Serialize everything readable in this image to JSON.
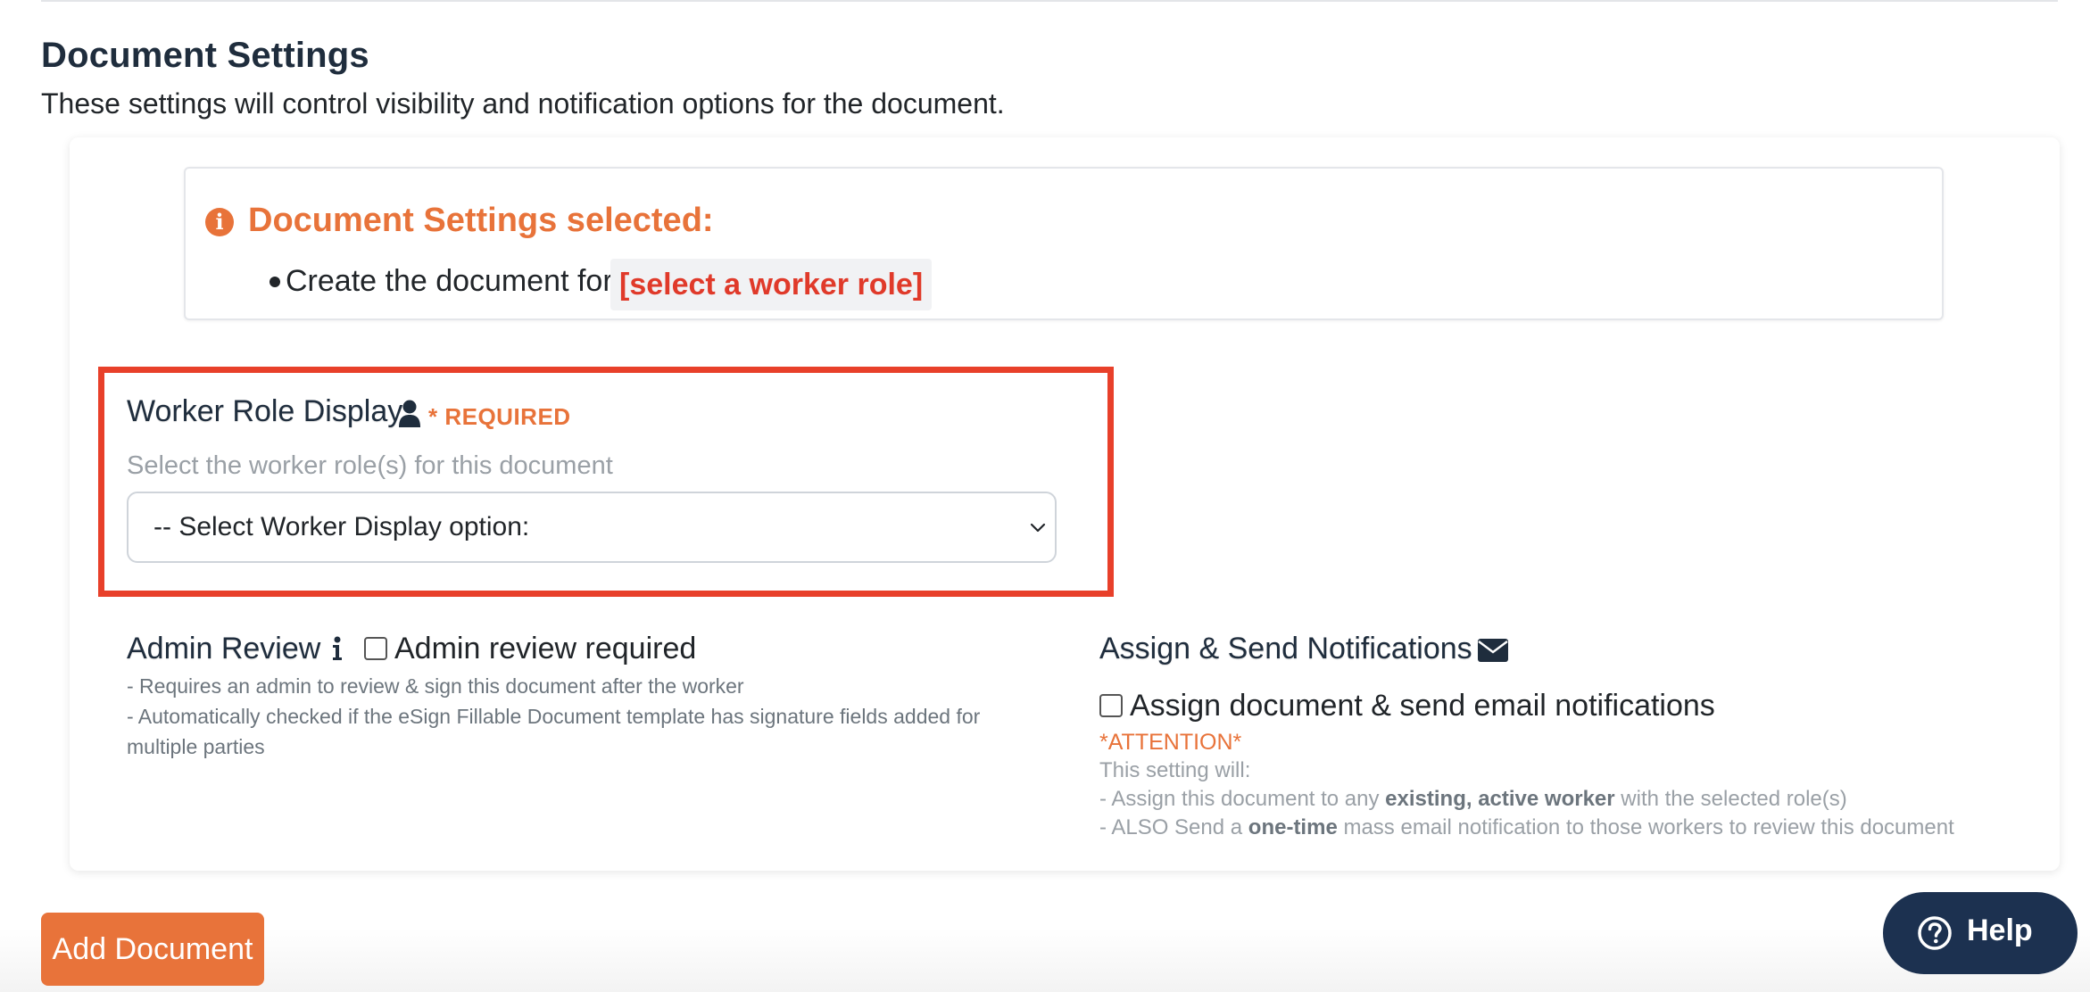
{
  "section": {
    "title": "Document Settings",
    "description": "These settings will control visibility and notification options for the document."
  },
  "summary": {
    "title": "Document Settings selected:",
    "items": [
      {
        "lead": "Create the document for",
        "value": "[select a worker role]"
      }
    ]
  },
  "worker_role": {
    "label": "Worker Role Display",
    "required": "* REQUIRED",
    "help": "Select the worker role(s) for this document",
    "select_value": "-- Select Worker Display option:"
  },
  "admin_review": {
    "title": "Admin Review",
    "checkbox_label": "Admin review required",
    "checked": false,
    "notes": [
      "- Requires an admin to review & sign this document after the worker",
      "- Automatically checked if the eSign Fillable Document template has signature fields added for multiple parties"
    ]
  },
  "assign_notifications": {
    "title": "Assign & Send Notifications",
    "checkbox_label": "Assign document & send email notifications",
    "checked": false,
    "attention": "*ATTENTION*",
    "note_intro": "This setting will:",
    "note_1_a": "- Assign this document to any ",
    "note_1_b": "existing, active worker",
    "note_1_c": " with the selected role(s)",
    "note_2_a": "- ALSO Send a ",
    "note_2_b": "one-time",
    "note_2_c": " mass email notification to those workers to review this document"
  },
  "actions": {
    "add_document": "Add Document",
    "help": "Help"
  },
  "colors": {
    "accent_orange": "#e8733a",
    "highlight_red": "#e8402a",
    "role_red": "#e03a2a",
    "navy": "#1c3150"
  },
  "icons": [
    "info-icon",
    "user-icon",
    "info-letter-icon",
    "envelope-icon",
    "question-circle-icon",
    "chevron-down-icon"
  ]
}
